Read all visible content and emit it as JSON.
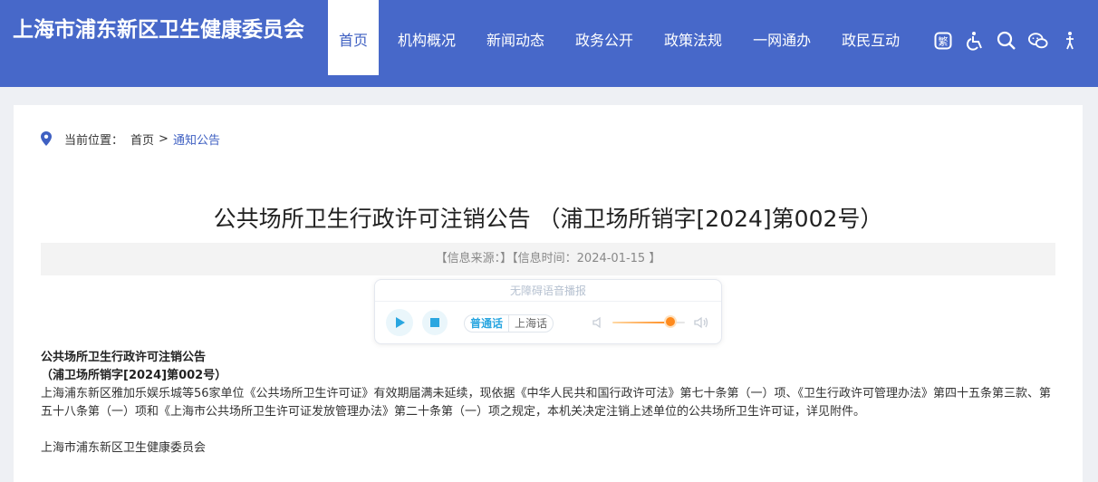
{
  "header": {
    "site_title": "上海市浦东新区卫生健康委员会",
    "nav": [
      "首页",
      "机构概况",
      "新闻动态",
      "政务公开",
      "政策法规",
      "一网通办",
      "政民互动"
    ],
    "tools": [
      "traditional-chinese-icon",
      "accessibility-icon",
      "search-icon",
      "wechat-icon",
      "elder-mode-icon"
    ]
  },
  "breadcrumb": {
    "label": "当前位置：",
    "home": "首页",
    "sep": ">",
    "current": "通知公告"
  },
  "article": {
    "title": "公共场所卫生行政许可注销公告 （浦卫场所销字[2024]第002号）",
    "meta": "【信息来源：】【信息时间：2024-01-15 】",
    "heading_line1": "公共场所卫生行政许可注销公告",
    "heading_line2": "（浦卫场所销字[2024]第002号）",
    "paragraph": "上海浦东新区雅加乐娱乐城等56家单位《公共场所卫生许可证》有效期届满未延续，现依据《中华人民共和国行政许可法》第七十条第（一）项、《卫生行政许可管理办法》第四十五条第三款、第五十八条第（一）项和《上海市公共场所卫生许可证发放管理办法》第二十条第（一）项之规定，本机关决定注销上述单位的公共场所卫生许可证，详见附件。",
    "signature": "上海市浦东新区卫生健康委员会"
  },
  "player": {
    "title": "无障碍语音播报",
    "lang_on": "普通话",
    "lang_off": "上海话",
    "volume": 0.8
  },
  "colors": {
    "header_bg": "#4768c9",
    "accent": "#3f60c2",
    "player_accent": "#2aa6e0",
    "volume": "#ff8a1c"
  }
}
